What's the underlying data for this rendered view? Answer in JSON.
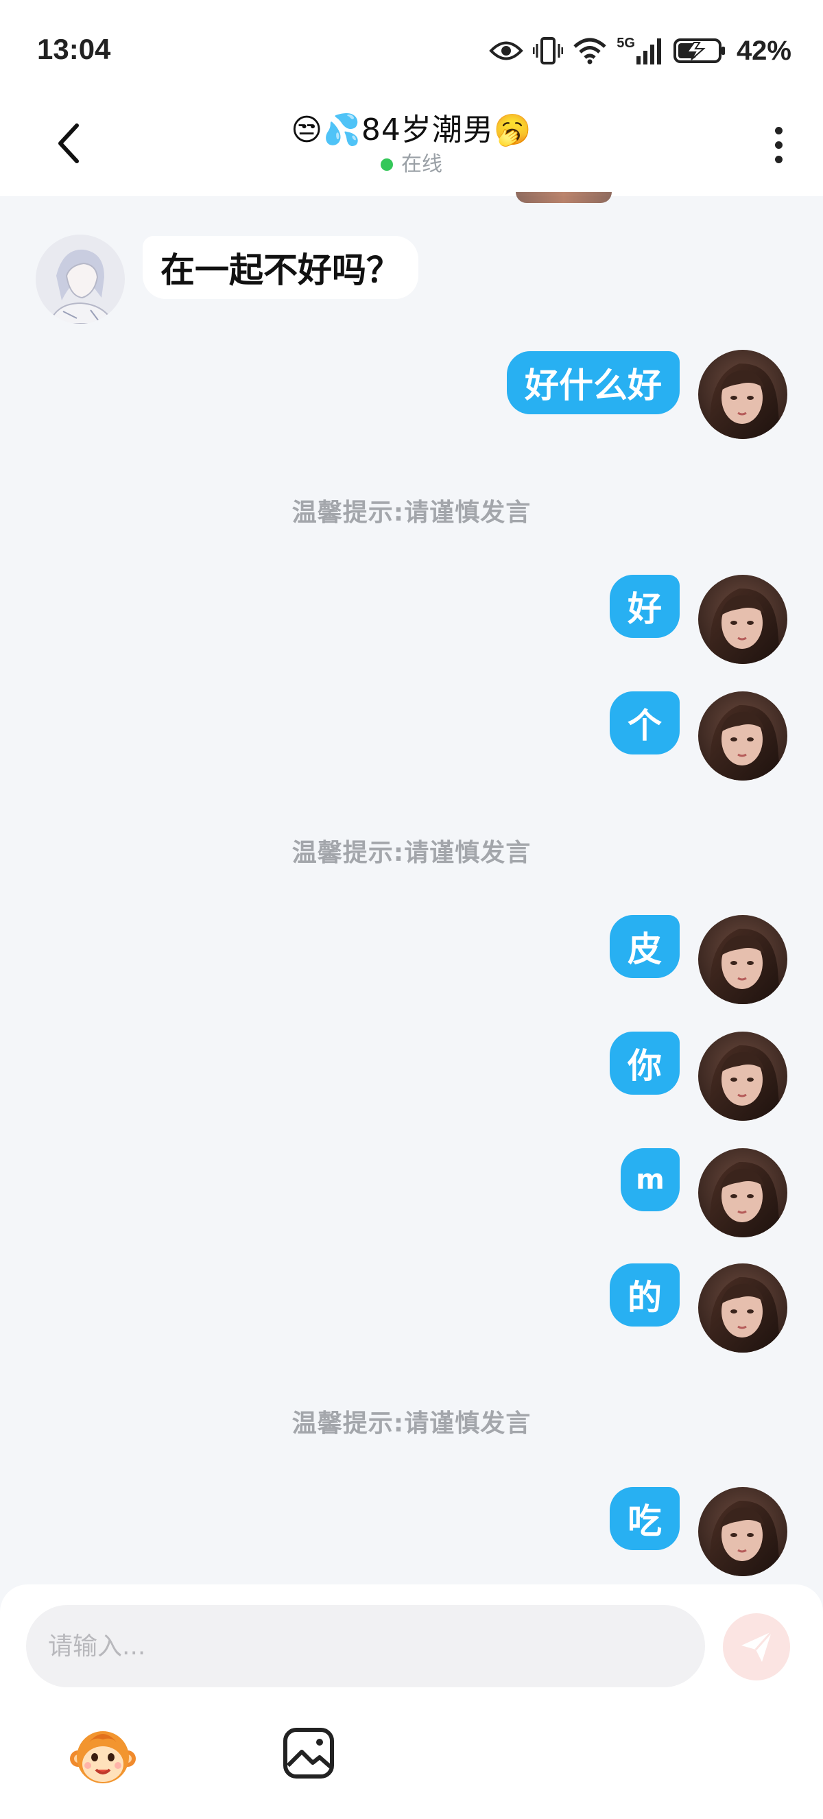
{
  "status_bar": {
    "time": "13:04",
    "network": "5G",
    "battery_percent": "42%"
  },
  "header": {
    "title": "😒💦84岁潮男🥱",
    "online_status": "在线",
    "colors": {
      "online_dot": "#34c759"
    }
  },
  "messages": [
    {
      "sender": "other",
      "text": "在一起不好吗？"
    },
    {
      "sender": "self",
      "text": "好什么好"
    },
    {
      "sender": "system",
      "text": "温馨提示:请谨慎发言"
    },
    {
      "sender": "self",
      "text": "好"
    },
    {
      "sender": "self",
      "text": "个"
    },
    {
      "sender": "system",
      "text": "温馨提示:请谨慎发言"
    },
    {
      "sender": "self",
      "text": "皮"
    },
    {
      "sender": "self",
      "text": "你"
    },
    {
      "sender": "self",
      "text": "m"
    },
    {
      "sender": "self",
      "text": "的"
    },
    {
      "sender": "system",
      "text": "温馨提示:请谨慎发言"
    },
    {
      "sender": "self",
      "text": "吃"
    }
  ],
  "input": {
    "placeholder": "请输入..."
  },
  "icons": {
    "back": "chevron-left-icon",
    "more": "more-vertical-icon",
    "send": "send-icon",
    "emoji": "monkey-emoji-icon",
    "image": "image-icon"
  },
  "colors": {
    "outgoing_bubble": "#28b0f2",
    "incoming_bubble": "#ffffff",
    "chat_background": "#f4f6f9",
    "send_button": "#fbe4e2"
  }
}
